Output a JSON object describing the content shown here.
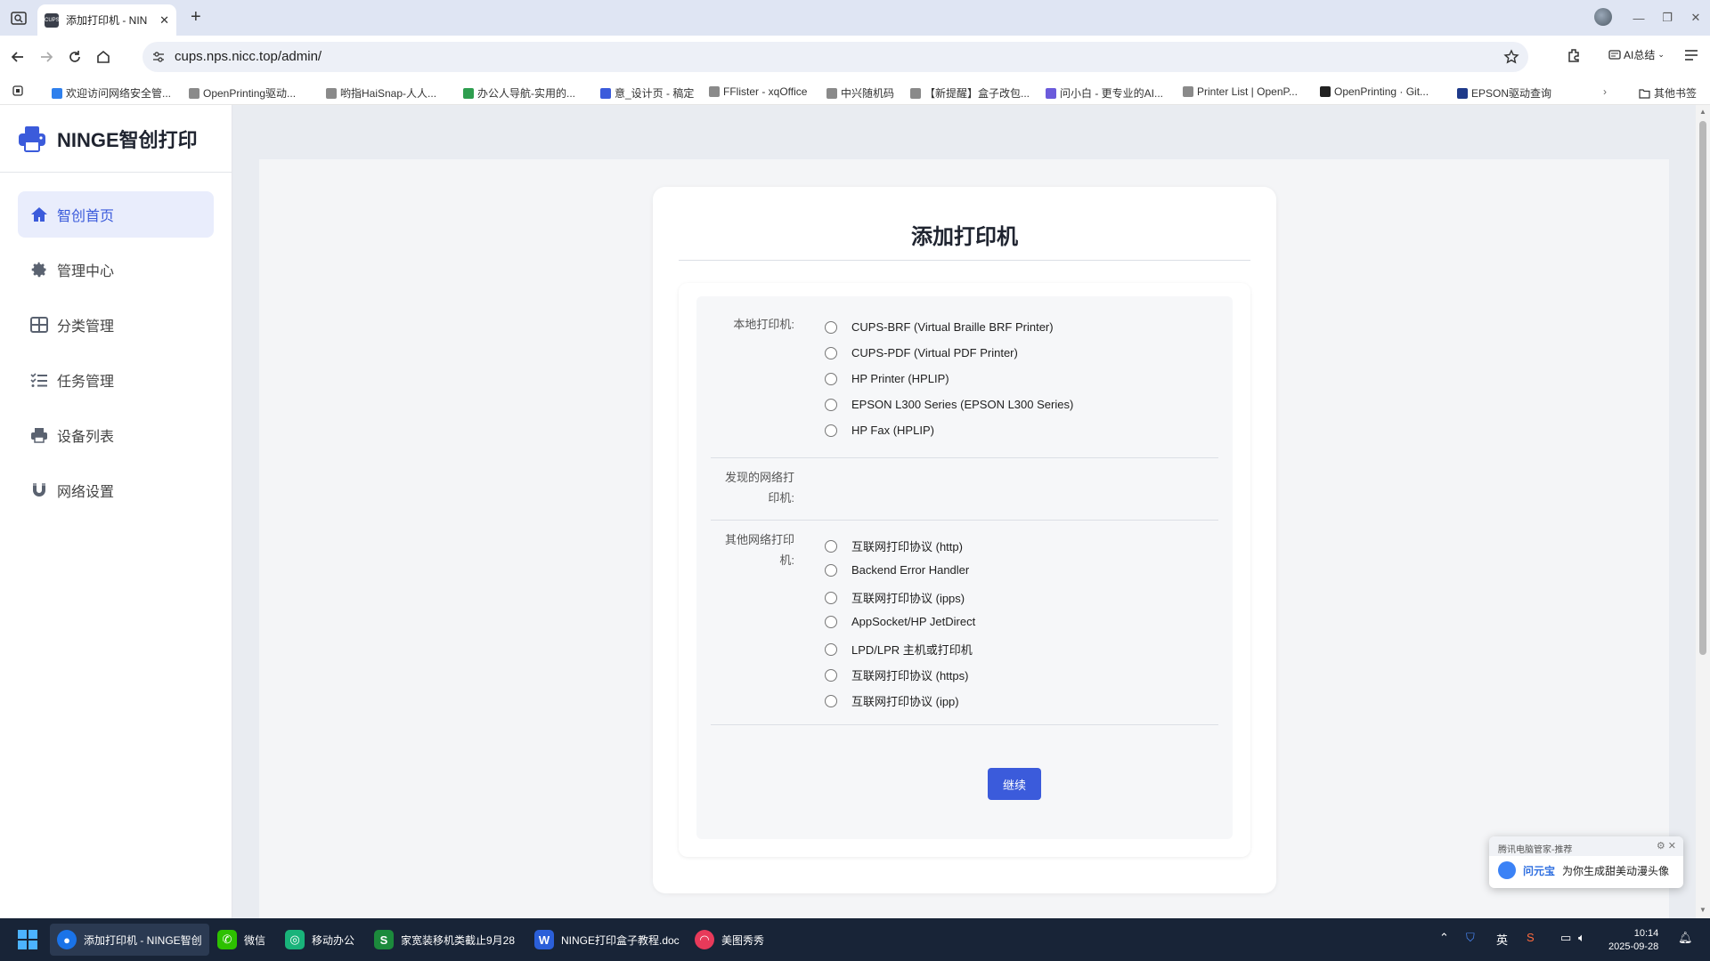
{
  "browser": {
    "tab_title": "添加打印机 - NIN",
    "favicon_text": "CUPS",
    "url": "cups.nps.nicc.top/admin/",
    "ai_summary_label": "AI总结",
    "bookmarks": [
      {
        "label": "欢迎访问网络安全管...",
        "color": "#2f80ed"
      },
      {
        "label": "OpenPrinting驱动...",
        "color": "#8a8a8a"
      },
      {
        "label": "哟指HaiSnap-人人...",
        "color": "#8a8a8a"
      },
      {
        "label": "办公人导航-实用的...",
        "color": "#2e9e4f"
      },
      {
        "label": "意_设计页 - 稿定",
        "color": "#3b5bdb"
      },
      {
        "label": "FFlister - xqOffice",
        "color": "#8a8a8a"
      },
      {
        "label": "中兴随机码",
        "color": "#8a8a8a"
      },
      {
        "label": "【新提醒】盒子改包...",
        "color": "#8a8a8a"
      },
      {
        "label": "问小白 - 更专业的AI...",
        "color": "#6b5bdb"
      },
      {
        "label": "Printer List | OpenP...",
        "color": "#8a8a8a"
      },
      {
        "label": "OpenPrinting · Git...",
        "color": "#222222"
      },
      {
        "label": "EPSON驱动查询",
        "color": "#1e3a8a"
      }
    ],
    "other_bookmarks": "其他书签"
  },
  "sidebar": {
    "logo_text": "NINGE智创打印",
    "items": [
      {
        "label": "智创首页",
        "icon": "home-icon",
        "active": true
      },
      {
        "label": "管理中心",
        "icon": "gear-icon",
        "active": false
      },
      {
        "label": "分类管理",
        "icon": "grid-icon",
        "active": false
      },
      {
        "label": "任务管理",
        "icon": "tasks-icon",
        "active": false
      },
      {
        "label": "设备列表",
        "icon": "printer-icon",
        "active": false
      },
      {
        "label": "网络设置",
        "icon": "magnet-icon",
        "active": false
      }
    ]
  },
  "main": {
    "title": "添加打印机",
    "local_label": "本地打印机:",
    "local_printers": [
      "CUPS-BRF (Virtual Braille BRF Printer)",
      "CUPS-PDF (Virtual PDF Printer)",
      "HP Printer (HPLIP)",
      "EPSON L300 Series (EPSON L300 Series)",
      "HP Fax (HPLIP)"
    ],
    "discovered_label": "发现的网络打印机:",
    "other_label": "其他网络打印机:",
    "other_printers": [
      "互联网打印协议 (http)",
      "Backend Error Handler",
      "互联网打印协议 (ipps)",
      "AppSocket/HP JetDirect",
      "LPD/LPR 主机或打印机",
      "互联网打印协议 (https)",
      "互联网打印协议 (ipp)"
    ],
    "continue_label": "继续"
  },
  "toast": {
    "header": "腾讯电脑管家-推荐",
    "brand": "问元宝",
    "message": "为你生成甜美动漫头像"
  },
  "taskbar": {
    "apps": [
      {
        "label": "添加打印机 - NINGE智创",
        "color": "#1a73e8",
        "glyph": "●"
      },
      {
        "label": "微信",
        "color": "#2dc100",
        "glyph": "✆"
      },
      {
        "label": "移动办公",
        "color": "#19b37a",
        "glyph": "◎"
      },
      {
        "label": "家宽装移机类截止9月28",
        "color": "#1c8a3c",
        "glyph": "S"
      },
      {
        "label": "NINGE打印盒子教程.doc",
        "color": "#2b5fd9",
        "glyph": "W"
      },
      {
        "label": "美图秀秀",
        "color": "#e83a5a",
        "glyph": "◠"
      }
    ],
    "ime": "英",
    "time": "10:14",
    "date": "2025-09-28"
  },
  "colors": {
    "accent": "#3b5bdb",
    "active_bg": "#e9edfc"
  }
}
